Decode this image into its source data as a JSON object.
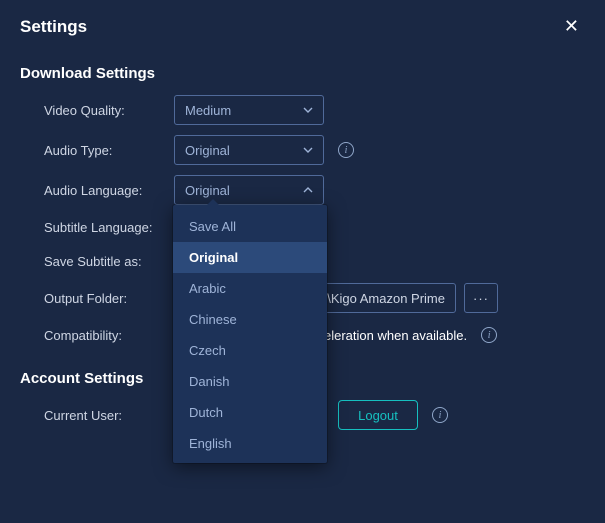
{
  "title": "Settings",
  "close_glyph": "✕",
  "sections": {
    "download": {
      "title": "Download Settings"
    },
    "account": {
      "title": "Account Settings"
    }
  },
  "rows": {
    "video_quality": {
      "label": "Video Quality:",
      "value": "Medium"
    },
    "audio_type": {
      "label": "Audio Type:",
      "value": "Original"
    },
    "audio_language": {
      "label": "Audio Language:",
      "value": "Original"
    },
    "subtitle_language": {
      "label": "Subtitle Language:"
    },
    "save_subtitle_as": {
      "label": "Save Subtitle as:"
    },
    "output_folder": {
      "label": "Output Folder:",
      "value": "ents\\Kigo Amazon Prime",
      "more": "···"
    },
    "compatibility": {
      "label": "Compatibility:",
      "text": "eleration when available."
    },
    "current_user": {
      "label": "Current User:"
    }
  },
  "logout_label": "Logout",
  "info_glyph": "i",
  "dropdown": {
    "items": [
      "Save All",
      "Original",
      "Arabic",
      "Chinese",
      "Czech",
      "Danish",
      "Dutch",
      "English"
    ],
    "selected_index": 1
  }
}
